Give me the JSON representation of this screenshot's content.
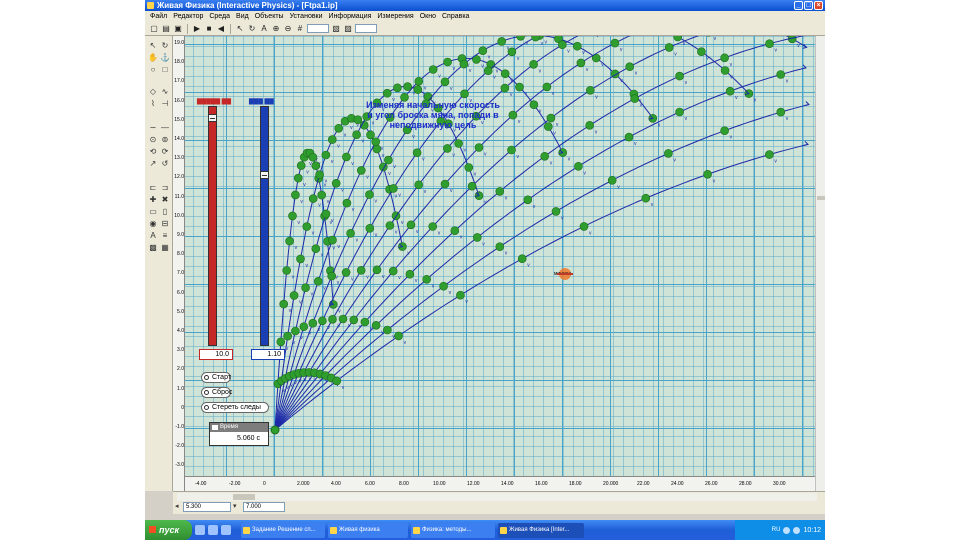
{
  "window": {
    "title": "Живая Физика (Interactive Physics) - [Ftpa1.ip]"
  },
  "menu": [
    "Файл",
    "Редактор",
    "Среда",
    "Вид",
    "Объекты",
    "Установки",
    "Информация",
    "Измерения",
    "Окно",
    "Справка"
  ],
  "instruction": [
    "Изменяя начальную скорость",
    "и угол броска мяча, попади в",
    "неподвижную цель"
  ],
  "controls": {
    "start": "Старт",
    "reset": "Сброс",
    "erase": "Стереть следы"
  },
  "timer": {
    "label": "Время",
    "value": "5.060 с"
  },
  "target": {
    "label": "мишень"
  },
  "sliders": {
    "speed": {
      "value": "10.0",
      "fraction": 0.03
    },
    "angle": {
      "value": "1.10",
      "fraction": 0.28
    }
  },
  "y_ticks": [
    "19.0",
    "18.0",
    "17.0",
    "16.0",
    "15.0",
    "14.0",
    "13.0",
    "12.0",
    "11.0",
    "10.0",
    "9.0",
    "8.0",
    "7.0",
    "6.0",
    "5.0",
    "4.0",
    "3.0",
    "2.0",
    "1.0",
    "0",
    "-1.0",
    "-2.0",
    "-3.0"
  ],
  "x_ticks": [
    "-4.00",
    "-2.00",
    "0",
    "2.000",
    "4.00",
    "6.00",
    "8.00",
    "10.00",
    "12.00",
    "14.00",
    "16.00",
    "18.00",
    "20.000",
    "22.00",
    "24.00",
    "26.00",
    "28.00",
    "30.00"
  ],
  "status": {
    "left_value": "5.300",
    "right_value": "7.000"
  },
  "taskbar": {
    "start": "пуск",
    "tasks": [
      "Задание Решение сп...",
      "Живая физика",
      "Физика: методы...",
      "Живая Физика [Inter..."
    ],
    "lang": "RU",
    "clock": "10:12"
  },
  "colors": {
    "speed_slider": "#c62828",
    "angle_slider": "#1a3fb5",
    "trajectory": "#1e2aa8",
    "ball": "#2f9e2f",
    "grid_bg": "#cfe3d6"
  }
}
